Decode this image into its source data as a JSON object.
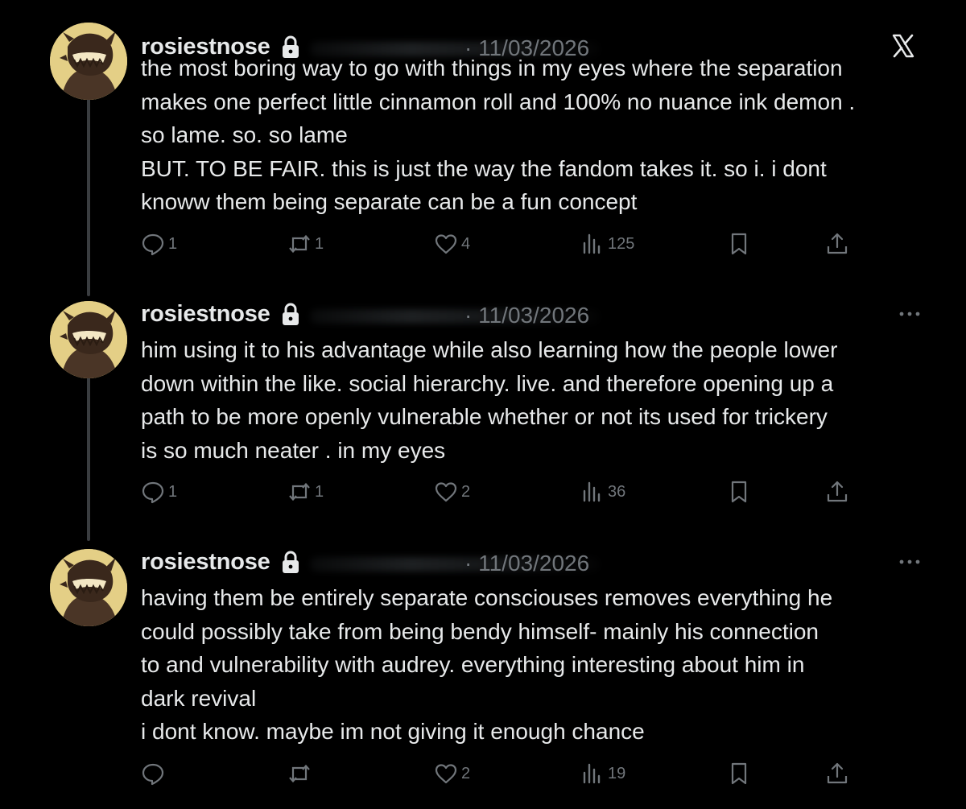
{
  "posts": [
    {
      "username": "rosiestnose",
      "date": "· 11/03/2026",
      "lines": [
        "the most boring way to go with things in my eyes where the separation",
        "makes one perfect little cinnamon roll and 100% no nuance ink demon .",
        "so lame. so. so lame",
        "BUT. TO BE FAIR. this is just the way the fandom takes it. so i. i dont",
        "knoww them being separate can be a fun concept"
      ],
      "replies": "1",
      "reposts": "1",
      "likes": "4",
      "views": "125"
    },
    {
      "username": "rosiestnose",
      "date": "· 11/03/2026",
      "lines": [
        "him using it to his advantage while also learning how the people lower",
        "down within the like. social hierarchy. live. and therefore opening up a",
        "path to be more openly vulnerable whether or not its used for trickery",
        "is so much neater . in my eyes"
      ],
      "replies": "1",
      "reposts": "1",
      "likes": "2",
      "views": "36"
    },
    {
      "username": "rosiestnose",
      "date": "· 11/03/2026",
      "lines": [
        "having them be entirely separate consciouses removes everything he",
        "could possibly take from being bendy himself- mainly his connection",
        "to and vulnerability with audrey. everything interesting about him in",
        "dark revival",
        "i dont know. maybe im not giving it enough chance"
      ],
      "replies": "",
      "reposts": "",
      "likes": "2",
      "views": "19"
    }
  ],
  "icons": {
    "header_first": "x-logo-icon",
    "header_rest": "more-options-icon",
    "verified": "lock-icon",
    "reply": "reply-icon",
    "repost": "repost-icon",
    "like": "heart-icon",
    "views": "views-icon",
    "bookmark": "bookmark-icon",
    "share": "share-icon"
  },
  "colors": {
    "background": "#000000",
    "text_primary": "#e7e9ea",
    "text_secondary": "#71767b",
    "avatar_bg": "#e4cf86",
    "connector": "#3a3d40"
  }
}
